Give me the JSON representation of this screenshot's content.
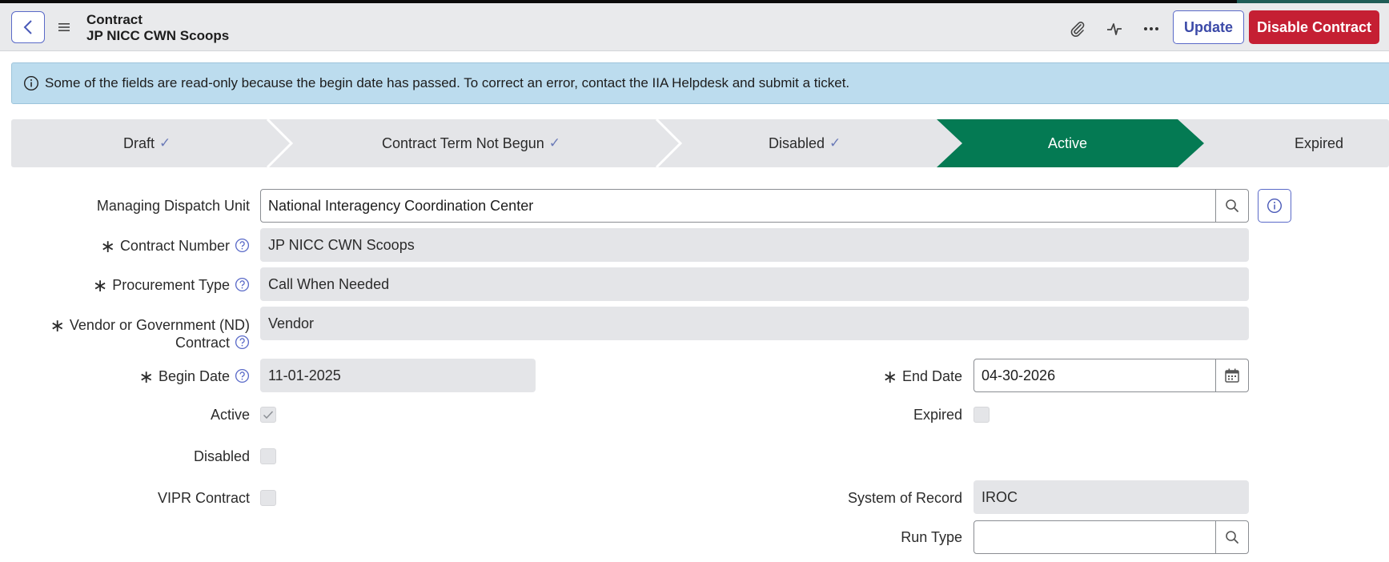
{
  "header": {
    "record_type": "Contract",
    "record_name": "JP NICC CWN Scoops",
    "update_label": "Update",
    "disable_label": "Disable Contract",
    "icons": [
      "back-icon",
      "hamburger-menu-icon",
      "paperclip-icon",
      "activity-icon",
      "more-options-icon"
    ]
  },
  "banner": {
    "icon": "info-icon",
    "text": "Some of the fields are read-only because the begin date has passed. To correct an error, contact the IIA Helpdesk and submit a ticket."
  },
  "stepper": {
    "steps": [
      {
        "label": "Draft",
        "state": "complete"
      },
      {
        "label": "Contract Term Not Begun",
        "state": "complete"
      },
      {
        "label": "Disabled",
        "state": "complete"
      },
      {
        "label": "Active",
        "state": "current"
      },
      {
        "label": "Expired",
        "state": "pending"
      }
    ],
    "check_glyph": "✓",
    "active_color": "#047a53"
  },
  "form": {
    "managing_dispatch_unit": {
      "label": "Managing Dispatch Unit",
      "value": "National Interagency Coordination Center"
    },
    "contract_number": {
      "label": "Contract Number",
      "value": "JP NICC CWN Scoops"
    },
    "procurement_type": {
      "label": "Procurement Type",
      "value": "Call When Needed"
    },
    "vendor_or_government": {
      "label_line1": "Vendor or Government (ND)",
      "label_line2": "Contract",
      "value": "Vendor"
    },
    "begin_date": {
      "label": "Begin Date",
      "value": "11-01-2025"
    },
    "end_date": {
      "label": "End Date",
      "value": "04-30-2026"
    },
    "active": {
      "label": "Active",
      "checked": true
    },
    "expired": {
      "label": "Expired",
      "checked": false
    },
    "disabled": {
      "label": "Disabled",
      "checked": false
    },
    "vipr_contract": {
      "label": "VIPR Contract",
      "checked": false
    },
    "system_of_record": {
      "label": "System of Record",
      "value": "IROC"
    },
    "run_type": {
      "label": "Run Type",
      "value": ""
    },
    "required_glyph": "∗"
  },
  "colors": {
    "primary": "#5a6ac8",
    "danger": "#c51f33",
    "banner_bg": "#bcdcee",
    "header_bg": "#e9eaec"
  }
}
